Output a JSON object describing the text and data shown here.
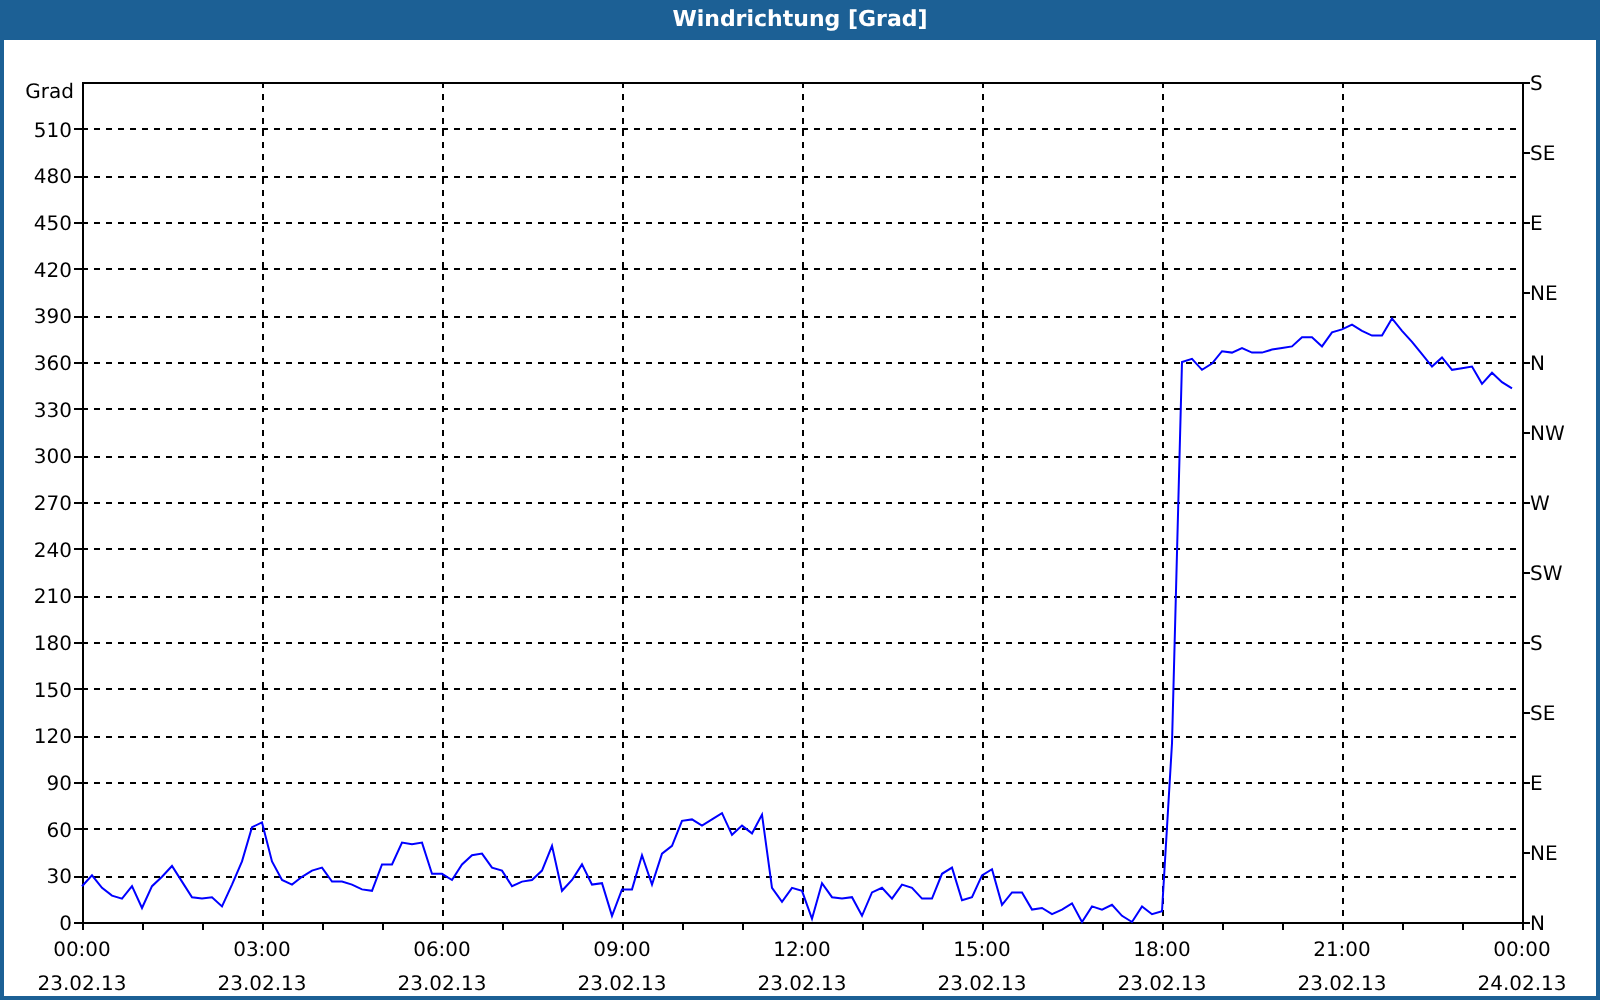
{
  "window": {
    "title": "Windrichtung [Grad]"
  },
  "chart": {
    "chart_data": {
      "type": "line",
      "ylabel": "Grad",
      "ylim": [
        0,
        540
      ],
      "categories": [
        "00:00 23.02.13",
        null,
        null,
        null,
        null,
        null,
        null,
        null,
        null,
        null,
        null,
        null,
        null,
        null,
        null,
        null,
        null,
        null,
        "03:00 23.02.13",
        null,
        null,
        null,
        null,
        null,
        null,
        null,
        null,
        null,
        null,
        null,
        null,
        null,
        null,
        null,
        null,
        null,
        "06:00 23.02.13",
        null,
        null,
        null,
        null,
        null,
        null,
        null,
        null,
        null,
        null,
        null,
        null,
        null,
        null,
        null,
        null,
        null,
        "09:00 23.02.13",
        null,
        null,
        null,
        null,
        null,
        null,
        null,
        null,
        null,
        null,
        null,
        null,
        null,
        null,
        null,
        null,
        null,
        "12:00 23.02.13",
        null,
        null,
        null,
        null,
        null,
        null,
        null,
        null,
        null,
        null,
        null,
        null,
        null,
        null,
        null,
        null,
        null,
        "15:00 23.02.13",
        null,
        null,
        null,
        null,
        null,
        null,
        null,
        null,
        null,
        null,
        null,
        null,
        null,
        null,
        null,
        null,
        null,
        "18:00 23.02.13",
        null,
        null,
        null,
        null,
        null,
        null,
        null,
        null,
        null,
        null,
        null,
        null,
        null,
        null,
        null,
        null,
        null,
        "21:00 23.02.13",
        null,
        null,
        null,
        null,
        null,
        null,
        null,
        null,
        null,
        null,
        null,
        null,
        null,
        null,
        null,
        null,
        null,
        "00:00 24.02.13"
      ],
      "yticks": [
        0,
        30,
        60,
        90,
        120,
        150,
        180,
        210,
        240,
        270,
        300,
        330,
        360,
        390,
        420,
        450,
        480,
        510
      ],
      "grid": true,
      "annotations": [
        "N",
        "NE",
        "E",
        "SE",
        "S",
        "SW",
        "W",
        "NW",
        "N",
        "NE",
        "E",
        "SE",
        "S"
      ],
      "series": [
        {
          "color": "#0000ff",
          "values": [
            23,
            30,
            22,
            17,
            15,
            23,
            9,
            23,
            29,
            36,
            26,
            16,
            15,
            16,
            10,
            24,
            39,
            61,
            64,
            39,
            27,
            24,
            29,
            33,
            35,
            26,
            26,
            24,
            21,
            20,
            37,
            37,
            51,
            50,
            51,
            31,
            31,
            27,
            37,
            43,
            44,
            35,
            33,
            23,
            26,
            27,
            33,
            49,
            20,
            27,
            37,
            24,
            25,
            4,
            21,
            21,
            43,
            24,
            44,
            49,
            65,
            66,
            62,
            66,
            70,
            56,
            62,
            57,
            69,
            22,
            13,
            22,
            20,
            2,
            25,
            16,
            15,
            16,
            4,
            19,
            22,
            15,
            24,
            22,
            15,
            15,
            31,
            35,
            14,
            16,
            30,
            34,
            11,
            19,
            19,
            8,
            9,
            5,
            8,
            12,
            0,
            10,
            8,
            11,
            4,
            0,
            10,
            5,
            7,
            115,
            360,
            362,
            355,
            359,
            367,
            366,
            369,
            366,
            366,
            368,
            369,
            370,
            376,
            376,
            370,
            379,
            381,
            384,
            380,
            377,
            377,
            388,
            380,
            373,
            365,
            357,
            363,
            355,
            356,
            357,
            346,
            353,
            347,
            343,
            null
          ]
        }
      ]
    }
  }
}
